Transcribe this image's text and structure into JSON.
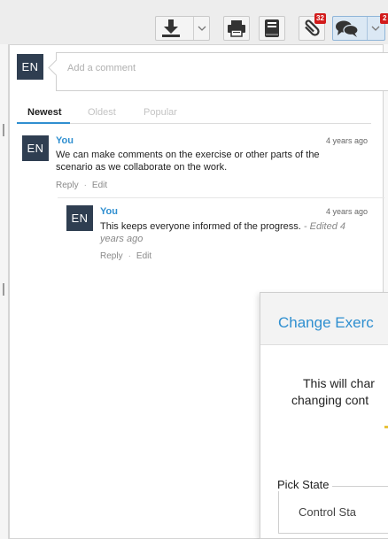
{
  "toolbar": {
    "download_icon": "download-icon",
    "print_icon": "printer-icon",
    "book_icon": "book-icon",
    "attachments": {
      "icon": "paperclip-icon",
      "count": "32"
    },
    "comments": {
      "icon": "chat-bubbles-icon",
      "count": "2"
    }
  },
  "composer": {
    "avatar": "EN",
    "placeholder": "Add a comment"
  },
  "tabs": [
    "Newest",
    "Oldest",
    "Popular"
  ],
  "comments": [
    {
      "avatar": "EN",
      "author": "You",
      "time": "4 years ago",
      "text_line1": "We can make comments on the exercise or other parts of the",
      "text_line2": "scenario as we collaborate on the work.",
      "reply": "Reply",
      "edit": "Edit"
    },
    {
      "avatar": "EN",
      "author": "You",
      "time": "4 years ago",
      "text": "This keeps everyone informed of the progress.",
      "edited_part1": "- Edited 4",
      "edited_part2": "years ago",
      "reply": "Reply",
      "edit": "Edit"
    }
  ],
  "modal": {
    "title": "Change Exerc",
    "line1": "This will char",
    "line2": "changing cont",
    "legend": "Pick State",
    "value": "Control Sta"
  },
  "colors": {
    "accent": "#2f8fd0",
    "avatar_bg": "#2f3e51",
    "badge": "#d21b1b"
  }
}
